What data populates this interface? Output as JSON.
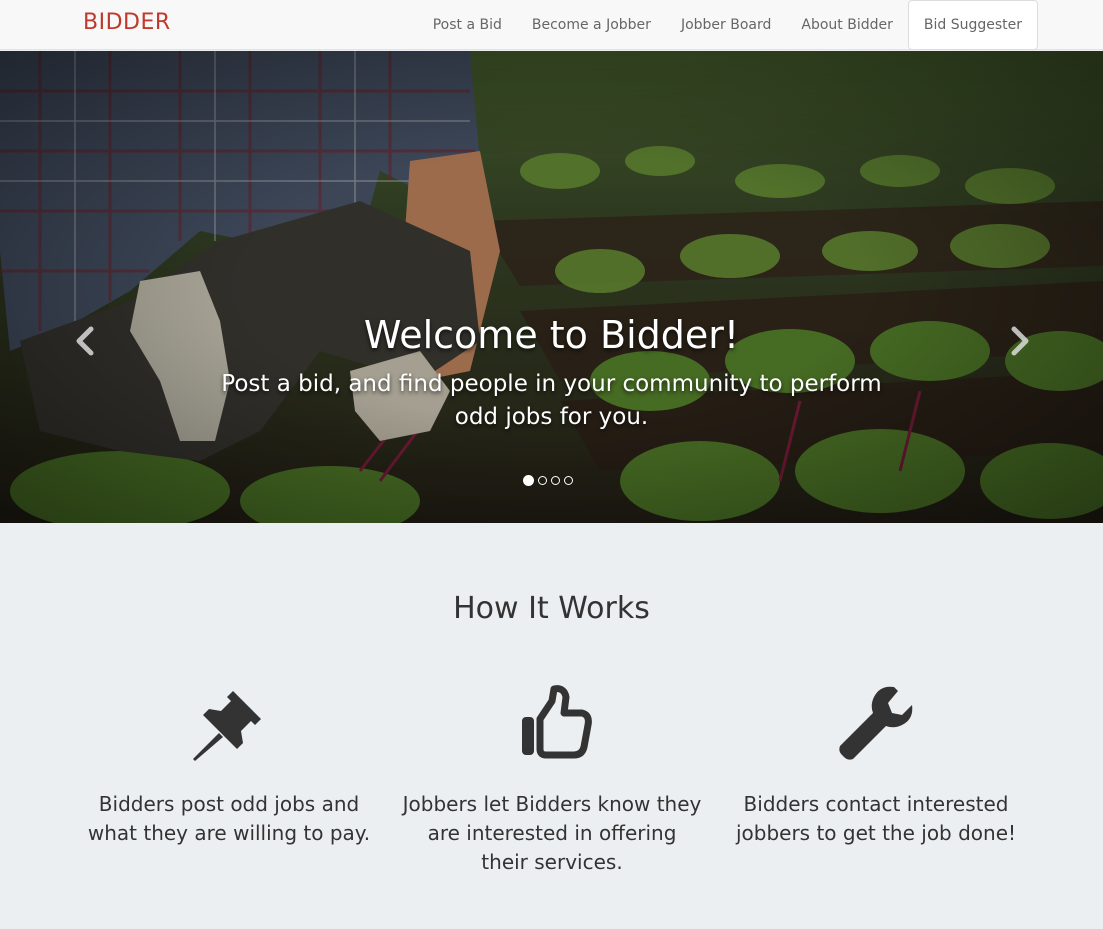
{
  "navbar": {
    "brand": "BIDDER",
    "links": [
      {
        "label": "Post a Bid"
      },
      {
        "label": "Become a Jobber"
      },
      {
        "label": "Jobber Board"
      },
      {
        "label": "About Bidder"
      },
      {
        "label": "Bid Suggester"
      }
    ]
  },
  "hero": {
    "title": "Welcome to Bidder!",
    "subtitle": "Post a bid, and find people in your community to perform odd jobs for you.",
    "prev_icon": "chevron-left-icon",
    "next_icon": "chevron-right-icon",
    "slide_count": 4,
    "active_slide": 1
  },
  "how": {
    "title": "How It Works",
    "features": [
      {
        "icon": "pushpin-icon",
        "text": "Bidders post odd jobs and what they are willing to pay."
      },
      {
        "icon": "thumbs-up-icon",
        "text": "Jobbers let Bidders know they are interested in offering their services."
      },
      {
        "icon": "wrench-icon",
        "text": "Bidders contact interested jobbers to get the job done!"
      }
    ]
  },
  "colors": {
    "brand": "#c0392b",
    "section_bg": "#eceff1",
    "icon": "#333333"
  }
}
